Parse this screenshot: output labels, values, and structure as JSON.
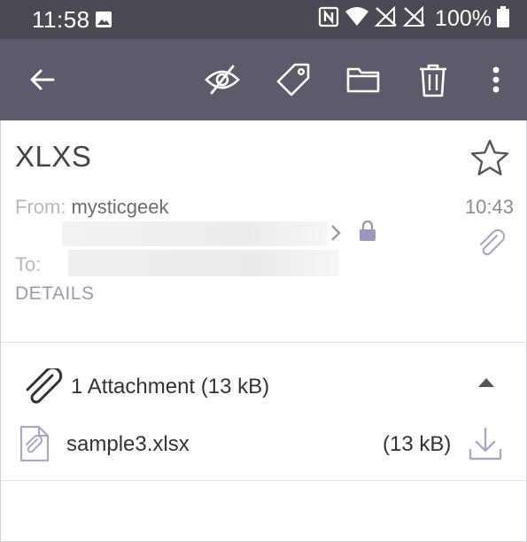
{
  "status_bar": {
    "time": "11:58",
    "battery_text": "100%",
    "icons": [
      "image-icon",
      "nfc-icon",
      "wifi-icon",
      "no-signal-icon",
      "no-signal-icon",
      "battery-icon"
    ]
  },
  "toolbar": {
    "icons": [
      "back-arrow-icon",
      "visibility-off-icon",
      "label-tag-icon",
      "move-to-folder-icon",
      "delete-trash-icon",
      "more-options-icon"
    ]
  },
  "email": {
    "subject": "XLXS",
    "from_label": "From:",
    "from_name": "mysticgeek",
    "time": "10:43",
    "to_label": "To:",
    "details_link": "DETAILS"
  },
  "attachments": {
    "header": "1 Attachment (13 kB)",
    "files": [
      {
        "name": "sample3.xlsx",
        "size": "(13 kB)"
      }
    ]
  },
  "colors": {
    "status_bar": "#4a4a55",
    "toolbar": "#5c5a6b",
    "accent": "#9a98b8"
  }
}
